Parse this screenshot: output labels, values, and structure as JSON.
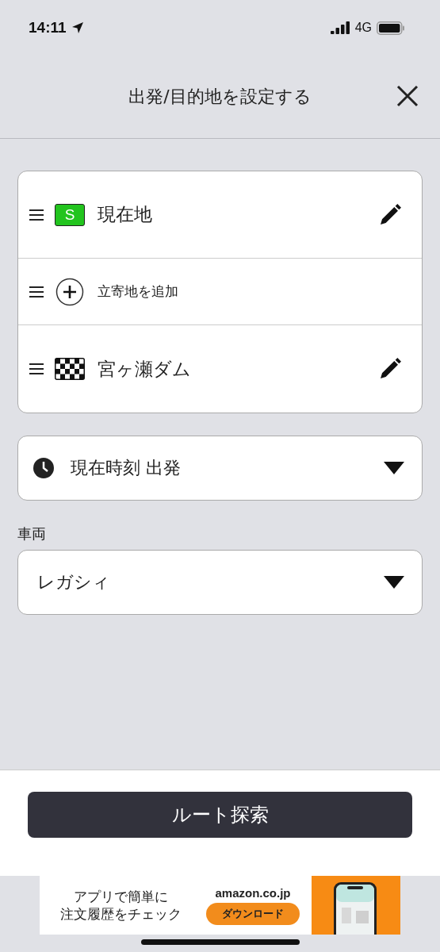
{
  "status_bar": {
    "time": "14:11",
    "network": "4G"
  },
  "header": {
    "title": "出発/目的地を設定する"
  },
  "stops": [
    {
      "kind": "start",
      "badge": "S",
      "label": "現在地"
    },
    {
      "kind": "waypoint",
      "label": "立寄地を追加"
    },
    {
      "kind": "goal",
      "label": "宮ヶ瀬ダム"
    }
  ],
  "departure": {
    "value": "現在時刻 出発"
  },
  "vehicle": {
    "label": "車両",
    "value": "レガシィ"
  },
  "search_button": "ルート探索",
  "ad": {
    "headline": [
      "アプリで簡単に",
      "注文履歴をチェック"
    ],
    "brand": "amazon.co.jp",
    "button": "ダウンロード"
  }
}
